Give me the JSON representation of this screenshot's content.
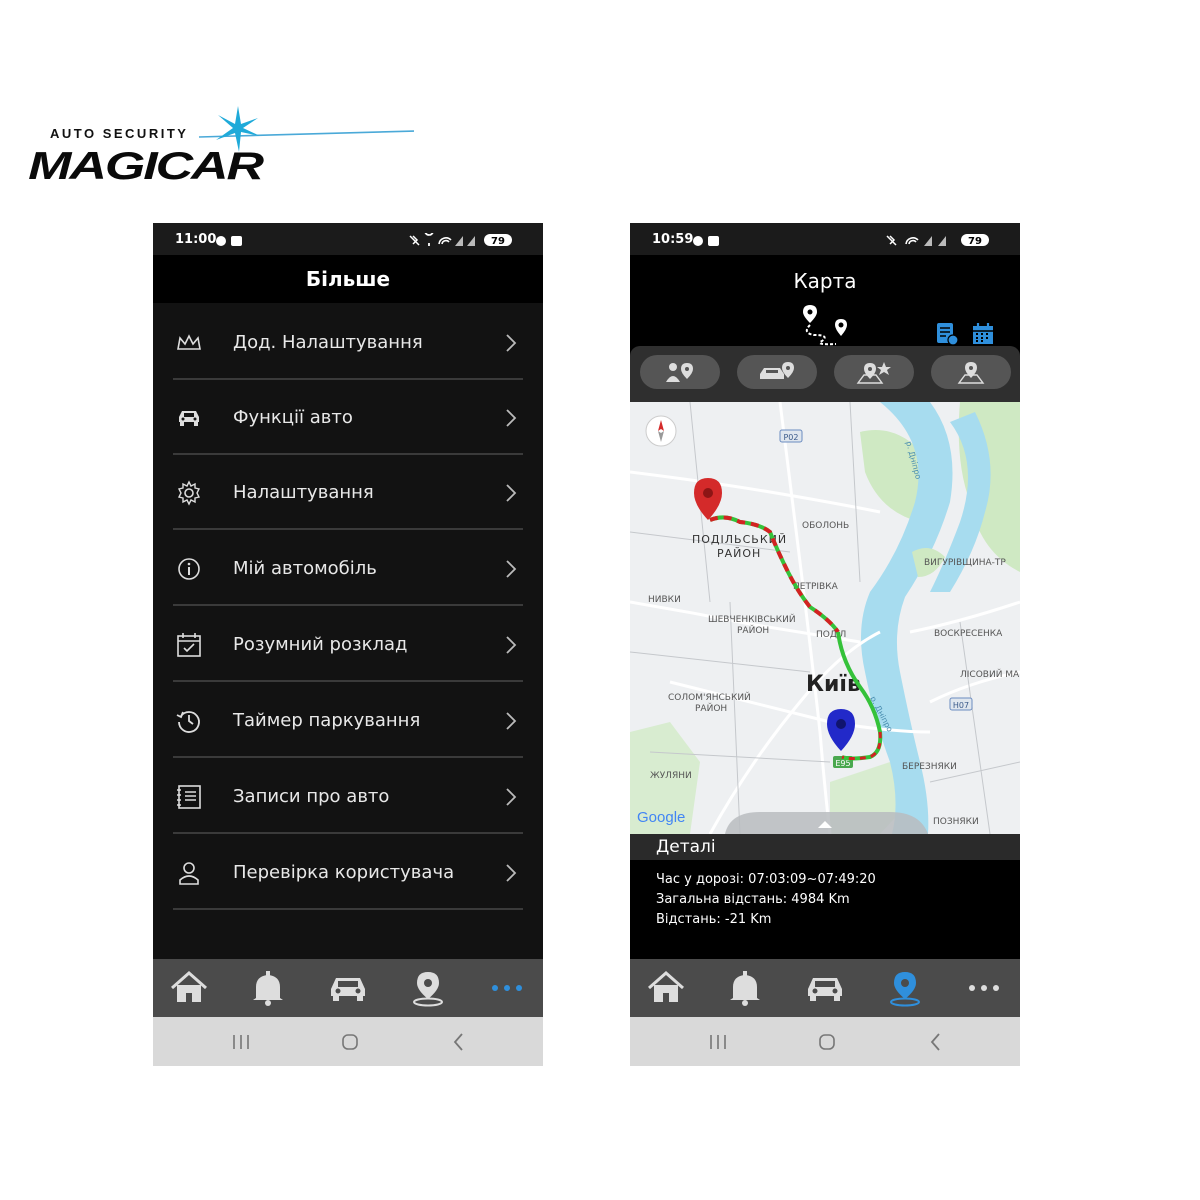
{
  "brand": {
    "tagline": "AUTO SECURITY",
    "name": "MAGICAR"
  },
  "phone_left": {
    "status": {
      "time": "11:00",
      "battery": "79"
    },
    "title": "Більше",
    "menu": [
      {
        "label": "Дод. Налаштування",
        "icon": "crown-icon"
      },
      {
        "label": "Функції авто",
        "icon": "car-icon"
      },
      {
        "label": "Налаштування",
        "icon": "gear-icon"
      },
      {
        "label": "Мій автомобіль",
        "icon": "info-icon"
      },
      {
        "label": "Розумний розклад",
        "icon": "calendar-check-icon"
      },
      {
        "label": "Таймер паркування",
        "icon": "history-icon"
      },
      {
        "label": "Записи про авто",
        "icon": "notebook-icon"
      },
      {
        "label": "Перевірка користувача",
        "icon": "user-icon"
      }
    ],
    "active_nav": "more"
  },
  "phone_right": {
    "status": {
      "time": "10:59",
      "battery": "79"
    },
    "title": "Карта",
    "map_labels": {
      "p02": "P02",
      "h07": "H07",
      "e95": "E95",
      "obolon": "ОБОЛОНЬ",
      "podilskyi_1": "ПОДІЛЬСЬКИЙ",
      "podilskyi_2": "РАЙОН",
      "vyhurivshchyna": "ВИГУРІВЩИНА-ТР",
      "petrivka": "ПЕТРІВКА",
      "nyvky": "НИВКИ",
      "shevchenkivskyi_1": "ШЕВЧЕНКІВСЬКИЙ",
      "shevchenkivskyi_2": "РАЙОН",
      "podil": "ПОДІЛ",
      "voskresenka": "ВОСКРЕСЕНКА",
      "kyiv": "Київ",
      "lisovyi": "ЛІСОВИЙ МА",
      "solomianskyi_1": "СОЛОМ'ЯНСЬКИЙ",
      "solomianskyi_2": "РАЙОН",
      "zhuliany": "ЖУЛЯНИ",
      "bereznyaky": "БЕРЕЗНЯКИ",
      "pozniaky": "ПОЗНЯКИ",
      "dnipro_1": "р. Дніпро",
      "dnipro_2": "р. Дніпро",
      "google": "Google"
    },
    "details": {
      "title": "Деталі",
      "road_time": "Час у дорозі: 07:03:09~07:49:20",
      "total_distance": "Загальна відстань: 4984 Km",
      "distance": "Відстань: -21 Km"
    },
    "active_nav": "map"
  },
  "colors": {
    "accent": "#2f8fdc",
    "route_green": "#35c23a",
    "route_red": "#d32222",
    "start_pin": "#d42a2a",
    "end_pin": "#2229c9",
    "water": "#a7dcef",
    "park": "#cfe9c3"
  }
}
